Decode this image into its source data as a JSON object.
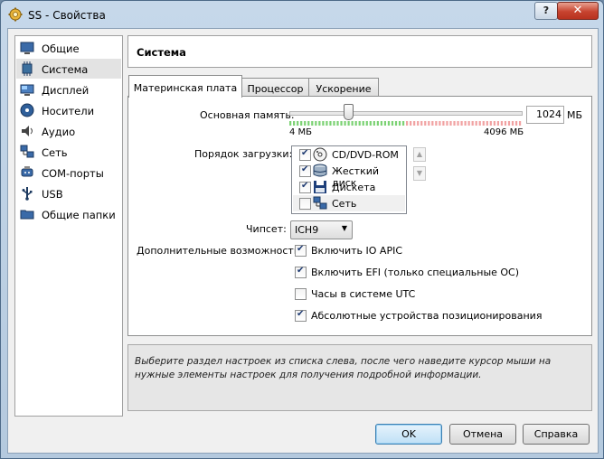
{
  "window": {
    "title": "SS - Свойства",
    "help_label": "?",
    "close_label": "✕",
    "icon": "gear-icon"
  },
  "sidebar": {
    "items": [
      {
        "label": "Общие",
        "icon": "monitor-icon",
        "selected": false
      },
      {
        "label": "Система",
        "icon": "chip-icon",
        "selected": true
      },
      {
        "label": "Дисплей",
        "icon": "display-icon",
        "selected": false
      },
      {
        "label": "Носители",
        "icon": "disc-icon",
        "selected": false
      },
      {
        "label": "Аудио",
        "icon": "speaker-icon",
        "selected": false
      },
      {
        "label": "Сеть",
        "icon": "network-icon",
        "selected": false
      },
      {
        "label": "COM-порты",
        "icon": "serial-port-icon",
        "selected": false
      },
      {
        "label": "USB",
        "icon": "usb-icon",
        "selected": false
      },
      {
        "label": "Общие папки",
        "icon": "folder-icon",
        "selected": false
      }
    ]
  },
  "header": {
    "title": "Система"
  },
  "tabs": [
    {
      "label": "Материнская плата",
      "active": true
    },
    {
      "label": "Процессор",
      "active": false
    },
    {
      "label": "Ускорение",
      "active": false
    }
  ],
  "memory": {
    "label": "Основная память:",
    "value": "1024",
    "unit": "МБ",
    "min_label": "4 МБ",
    "max_label": "4096 МБ",
    "value_mb": 1024,
    "min_mb": 4,
    "max_mb": 4096
  },
  "boot": {
    "label": "Порядок загрузки:",
    "items": [
      {
        "label": "CD/DVD-ROM",
        "checked": true,
        "icon": "cd-icon"
      },
      {
        "label": "Жесткий диск",
        "checked": true,
        "icon": "hard-disk-icon"
      },
      {
        "label": "Дискета",
        "checked": true,
        "icon": "floppy-icon"
      },
      {
        "label": "Сеть",
        "checked": false,
        "icon": "network-icon"
      }
    ],
    "up_glyph": "▲",
    "down_glyph": "▼"
  },
  "chipset": {
    "label": "Чипсет:",
    "value": "ICH9",
    "arrow": "▼"
  },
  "features": {
    "label": "Дополнительные возможности:",
    "items": [
      {
        "label": "Включить IO APIC",
        "checked": true
      },
      {
        "label": "Включить EFI (только специальные ОС)",
        "checked": true
      },
      {
        "label": "Часы в системе UTC",
        "checked": false
      },
      {
        "label": "Абсолютные устройства позиционирования",
        "checked": true
      }
    ]
  },
  "info": {
    "text": "Выберите раздел настроек из списка слева, после чего наведите курсор мыши на нужные элементы настроек для получения подробной информации."
  },
  "buttons": {
    "ok": "OK",
    "cancel": "Отмена",
    "help": "Справка"
  },
  "colors": {
    "scale_green": "#7cd274",
    "scale_red": "#f1a2a2",
    "accent": "#3c7fb1"
  }
}
